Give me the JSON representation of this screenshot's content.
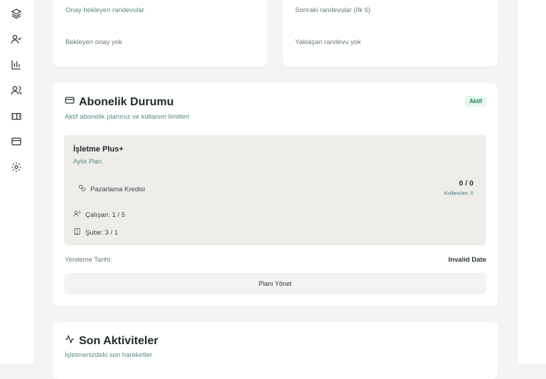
{
  "cards": {
    "pending": {
      "subtitle": "Onay bekleyen randevular",
      "empty": "Bekleyen onay yok"
    },
    "upcoming": {
      "subtitle": "Sonraki randevular (İlk 6)",
      "empty": "Yaklaşan randevu yok"
    }
  },
  "subscription": {
    "title": "Abonelik Durumu",
    "description": "Aktif abonelik planınız ve kullanım limitleri",
    "badge": "Aktif",
    "plan_name": "İşletme Plus+",
    "plan_type": "Aylık Plan",
    "marketing_label": "Pazarlama Kredisi",
    "marketing_value": "0 / 0",
    "marketing_used": "Kullanılan: 0",
    "employees": "Çalışan: 1 / 5",
    "branches": "Şube: 3 / 1",
    "renewal_label": "Yenileme Tarihi:",
    "renewal_value": "Invalid Date",
    "manage_button": "Planı Yönet"
  },
  "activities": {
    "title": "Son Aktiviteler",
    "description": "İşletmenizdeki son hareketler"
  },
  "sidebar": {
    "icons": [
      "layers-icon",
      "user-check-icon",
      "bar-chart-icon",
      "users-icon",
      "ticket-icon",
      "database-icon",
      "settings-icon"
    ]
  },
  "colors": {
    "accent": "#5a8a86",
    "badge_bg": "#e6f6ee",
    "badge_text": "#1f7a55",
    "panel": "#eeedea"
  }
}
